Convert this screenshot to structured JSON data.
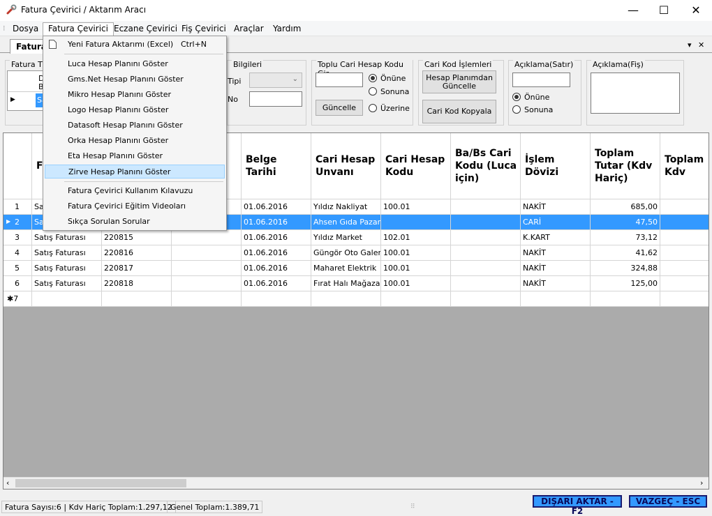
{
  "window": {
    "title": "Fatura Çevirici / Aktarım Aracı",
    "minimize": "—",
    "maximize": "☐",
    "close": "✕"
  },
  "menubar": [
    "Dosya",
    "Fatura Çevirici",
    "Eczane Çevirici",
    "Fiş Çevirici",
    "Araçlar",
    "Yardım"
  ],
  "tab": {
    "label": "Fatura",
    "dropdown_glyph": "▾",
    "close_glyph": "✕"
  },
  "groups": {
    "fatura_tipi": {
      "label": "Fatura Ti",
      "row1_a": "D",
      "row1_b": "B",
      "row2": "Sa"
    },
    "fis_bilgileri": {
      "label": "Bilgileri",
      "tipi": "Tipi",
      "no": "No"
    },
    "toplu_cari": {
      "label": "Toplu Cari Hesap Kodu Gir",
      "button": "Güncelle",
      "radios": [
        "Önüne",
        "Sonuna",
        "Üzerine"
      ]
    },
    "cari_kod": {
      "label": "Cari Kod İşlemleri",
      "btn1": "Hesap Planımdan Güncelle",
      "btn2": "Cari Kod Kopyala"
    },
    "aciklama_satir": {
      "label": "Açıklama(Satır)",
      "radios": [
        "Önüne",
        "Sonuna"
      ]
    },
    "aciklama_fis": {
      "label": "Açıklama(Fiş)"
    }
  },
  "grid": {
    "headers": [
      "F T",
      "",
      "",
      "Belge Tarihi",
      "Cari Hesap Unvanı",
      "Cari Hesap Kodu",
      "Ba/Bs Cari Kodu (Luca için)",
      "İşlem Dövizi",
      "Toplam Tutar (Kdv Hariç)",
      "Toplam Kdv"
    ],
    "rows": [
      {
        "n": "1",
        "a": "Sa",
        "b": "",
        "date": "01.06.2016",
        "unvan": "Yıldız Nakliyat",
        "kod": "100.01",
        "doviz": "NAKİT",
        "tutar": "685,00"
      },
      {
        "n": "2",
        "a": "Sa",
        "b": "",
        "date": "01.06.2016",
        "unvan": "Ahsen Gıda Pazarı",
        "kod": "",
        "doviz": "CARİ",
        "tutar": "47,50"
      },
      {
        "n": "3",
        "a": "Satış Faturası",
        "b": "220815",
        "date": "01.06.2016",
        "unvan": "Yıldız Market",
        "kod": "102.01",
        "doviz": "K.KART",
        "tutar": "73,12"
      },
      {
        "n": "4",
        "a": "Satış Faturası",
        "b": "220816",
        "date": "01.06.2016",
        "unvan": "Güngör Oto Galeri",
        "kod": "100.01",
        "doviz": "NAKİT",
        "tutar": "41,62"
      },
      {
        "n": "5",
        "a": "Satış Faturası",
        "b": "220817",
        "date": "01.06.2016",
        "unvan": "Maharet Elektrik",
        "kod": "100.01",
        "doviz": "NAKİT",
        "tutar": "324,88"
      },
      {
        "n": "6",
        "a": "Satış Faturası",
        "b": "220818",
        "date": "01.06.2016",
        "unvan": "Fırat Halı Mağazası",
        "kod": "100.01",
        "doviz": "NAKİT",
        "tutar": "125,00"
      }
    ],
    "new_row": "✱7"
  },
  "dropdown": {
    "items": [
      {
        "label": "Yeni Fatura Aktarımı (Excel)",
        "shortcut": "Ctrl+N"
      },
      {
        "label": "Luca Hesap Planını Göster"
      },
      {
        "label": "Gms.Net Hesap Planını Göster"
      },
      {
        "label": "Mikro Hesap Planını Göster"
      },
      {
        "label": "Logo Hesap Planını Göster"
      },
      {
        "label": "Datasoft Hesap Planını Göster"
      },
      {
        "label": "Orka Hesap Planını Göster"
      },
      {
        "label": "Eta Hesap Planını Göster"
      },
      {
        "label": "Zirve Hesap Planını Göster"
      },
      {
        "label": "Fatura Çevirici Kullanım Kılavuzu"
      },
      {
        "label": "Fatura Çevirici Eğitim Videoları"
      },
      {
        "label": "Sıkça Sorulan Sorular"
      }
    ]
  },
  "status": {
    "left": "Fatura Sayısı:6 | Kdv Hariç Toplam:1.297,12",
    "middle": "Genel Toplam:1.389,71",
    "export_button": "DIŞARI AKTAR - F2",
    "cancel_button": "VAZGEÇ - ESC"
  },
  "colors": {
    "selection": "#3399ff",
    "menu_highlight": "#cce8ff",
    "button_border": "#1a1a6e"
  }
}
